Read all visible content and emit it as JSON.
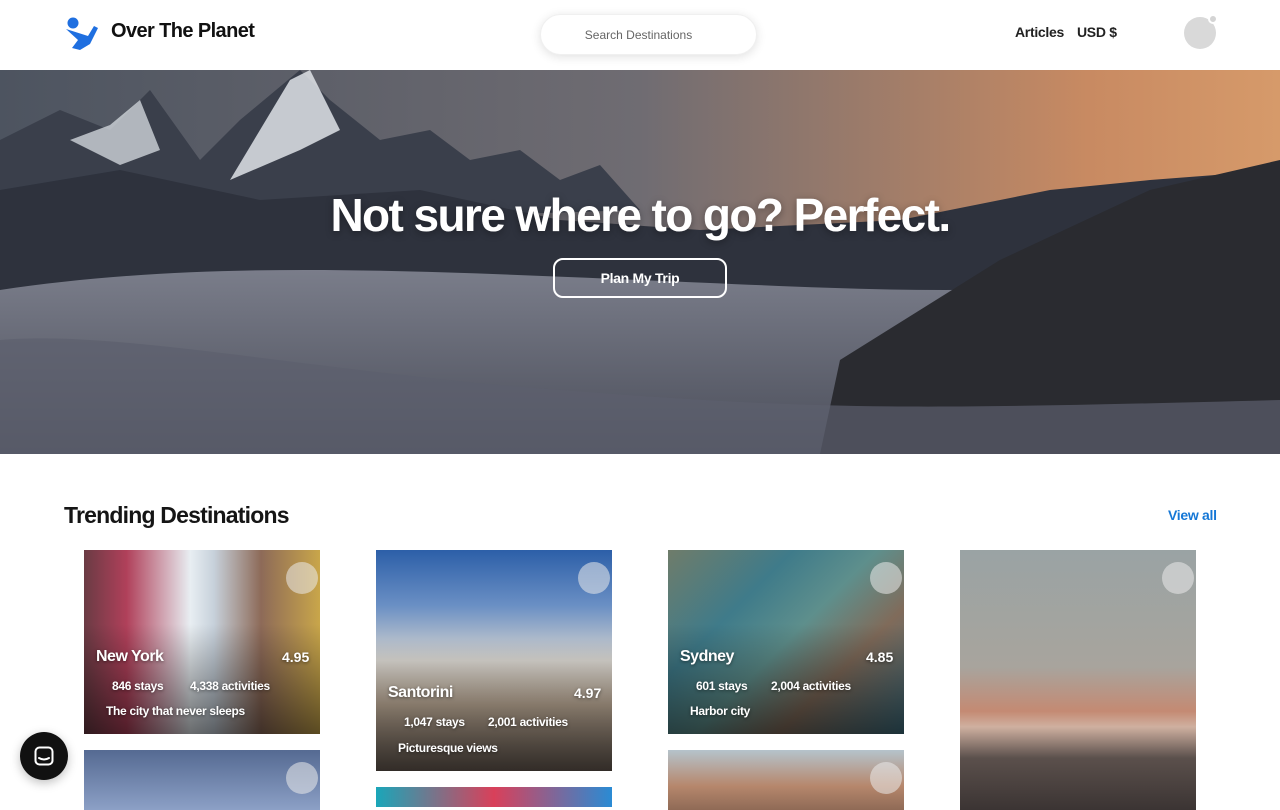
{
  "header": {
    "brand": "Over The Planet",
    "logo_icon": "person-logo-icon",
    "search_placeholder": "Search Destinations",
    "nav_articles": "Articles",
    "nav_currency": "USD $",
    "avatar_icon": "user-avatar-icon"
  },
  "hero": {
    "title": "Not sure where to go? Perfect.",
    "cta": "Plan My Trip"
  },
  "trending": {
    "title": "Trending Destinations",
    "view_all": "View all",
    "cards": [
      {
        "name": "New York",
        "rating": "4.95",
        "stays": "846 stays",
        "activities": "4,338 activities",
        "tagline": "The city that never sleeps"
      },
      {
        "name": "Santorini",
        "rating": "4.97",
        "stays": "1,047 stays",
        "activities": "2,001 activities",
        "tagline": "Picturesque views"
      },
      {
        "name": "Sydney",
        "rating": "4.85",
        "stays": "601 stays",
        "activities": "2,004 activities",
        "tagline": "Harbor city"
      }
    ]
  },
  "chat": {
    "icon": "chat-icon"
  },
  "colors": {
    "accent": "#1577d6",
    "logo": "#1f6fe0"
  }
}
